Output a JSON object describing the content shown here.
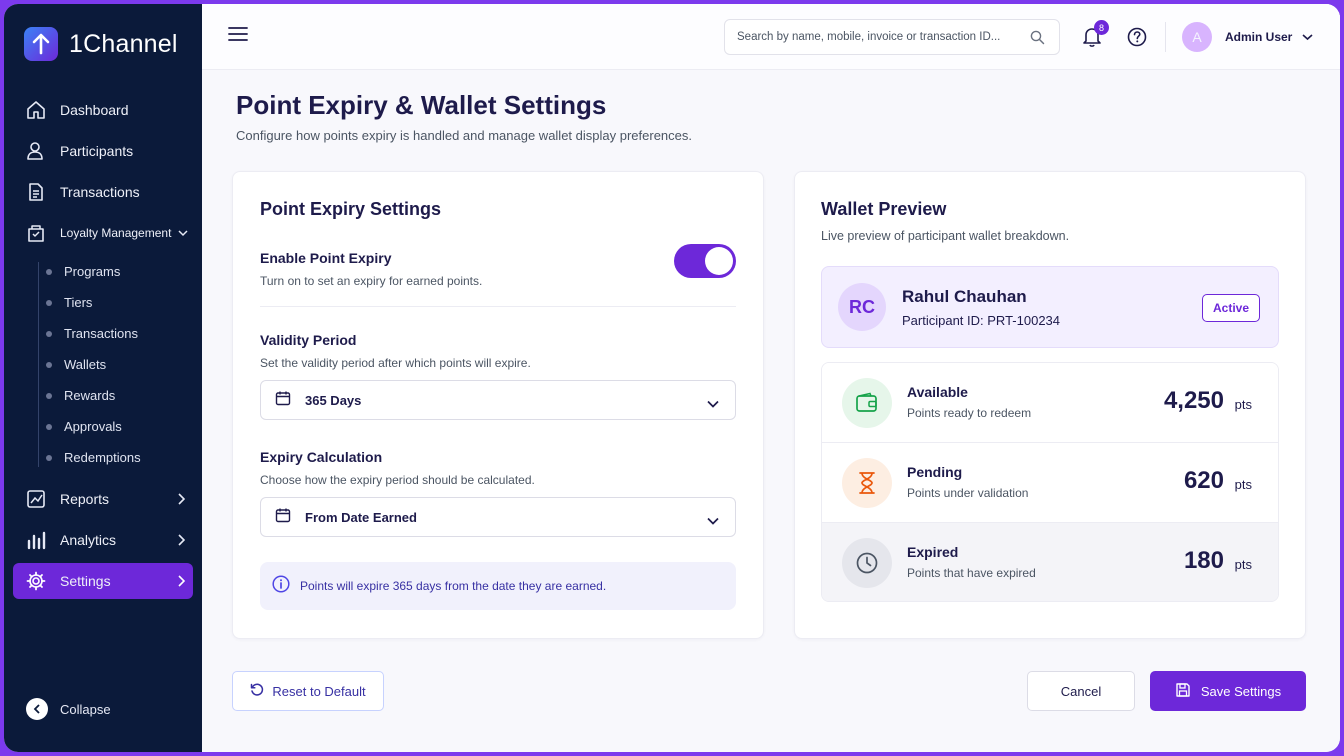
{
  "brand": {
    "name": "1Channel"
  },
  "sidebar": {
    "items": [
      {
        "label": "Dashboard",
        "icon": "home-icon"
      },
      {
        "label": "Participants",
        "icon": "users-icon"
      },
      {
        "label": "Transactions",
        "icon": "document-icon"
      },
      {
        "label": "Loyalty Management",
        "icon": "gift-box-icon"
      }
    ],
    "subitems": [
      "Programs",
      "Tiers",
      "Transactions",
      "Wallets",
      "Rewards",
      "Approvals",
      "Redemptions"
    ],
    "bottom_items": [
      {
        "label": "Reports",
        "icon": "report-chart-icon"
      },
      {
        "label": "Analytics",
        "icon": "bar-chart-icon"
      },
      {
        "label": "Settings",
        "icon": "gear-icon",
        "active": true
      }
    ],
    "collapse_label": "Collapse"
  },
  "topbar": {
    "search_placeholder": "Search by name, mobile, invoice or transaction ID...",
    "notification_count": "8",
    "user_initial": "A",
    "user_name": "Admin User"
  },
  "page": {
    "title": "Point Expiry & Wallet Settings",
    "subtitle": "Configure how points expiry is handled and manage wallet display preferences."
  },
  "expiry": {
    "title": "Point Expiry Settings",
    "enable_label": "Enable Point Expiry",
    "enable_help": "Turn on to set an expiry for earned points.",
    "enabled": true,
    "validity_label": "Validity Period",
    "validity_help": "Set the validity period after which points will expire.",
    "validity_value": "365 Days",
    "calc_label": "Expiry Calculation",
    "calc_help": "Choose how the expiry period should be calculated.",
    "calc_value": "From Date Earned",
    "info_text": "Points will expire 365 days from the date they are earned."
  },
  "wallet": {
    "title": "Wallet Preview",
    "subtitle": "Live preview of participant wallet breakdown.",
    "participant": {
      "initials": "RC",
      "name": "Rahul Chauhan",
      "id_text": "Participant ID: PRT-100234",
      "status": "Active"
    },
    "rows": [
      {
        "title": "Available",
        "sub": "Points ready to redeem",
        "value": "4,250",
        "unit": "pts",
        "icon": "wallet-icon",
        "color": "#16a34a"
      },
      {
        "title": "Pending",
        "sub": "Points under validation",
        "value": "620",
        "unit": "pts",
        "icon": "hourglass-icon",
        "color": "#ea580c"
      },
      {
        "title": "Expired",
        "sub": "Points that have expired",
        "value": "180",
        "unit": "pts",
        "icon": "clock-icon",
        "color": "#4b5563"
      }
    ]
  },
  "actions": {
    "reset_label": "Reset to Default",
    "cancel_label": "Cancel",
    "save_label": "Save Settings"
  },
  "colors": {
    "accent": "#6d28d9",
    "sidebar": "#0b1a3a"
  }
}
